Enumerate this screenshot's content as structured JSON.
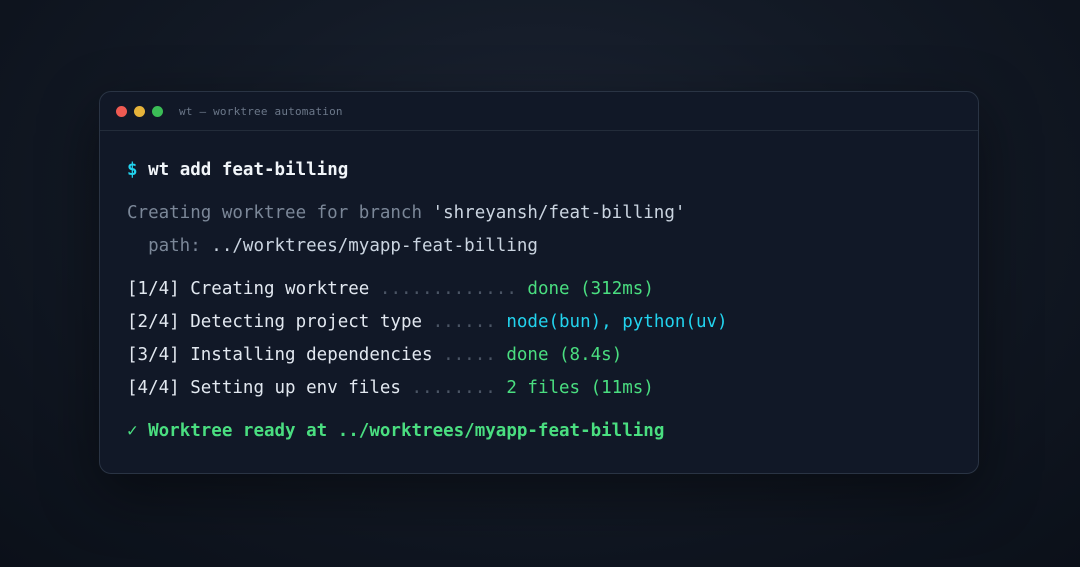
{
  "window": {
    "title": "wt — worktree automation"
  },
  "command": {
    "prompt": "$",
    "text": "wt add feat-billing"
  },
  "output": {
    "creating_prefix": "Creating worktree for branch ",
    "branch": "'shreyansh/feat-billing'",
    "path_label": "  path: ",
    "path_value": "../worktrees/myapp-feat-billing"
  },
  "steps": [
    {
      "index": "[1/4]",
      "label": "Creating worktree",
      "dots": ".............",
      "result": "done (312ms)",
      "result_color": "#4ade80"
    },
    {
      "index": "[2/4]",
      "label": "Detecting project type",
      "dots": "......",
      "result": "node(bun), python(uv)",
      "result_color": "#22d3ee"
    },
    {
      "index": "[3/4]",
      "label": "Installing dependencies",
      "dots": ".....",
      "result": "done (8.4s)",
      "result_color": "#4ade80"
    },
    {
      "index": "[4/4]",
      "label": "Setting up env files",
      "dots": "........",
      "result": "2 files (11ms)",
      "result_color": "#4ade80"
    }
  ],
  "final": {
    "check": "✓",
    "message": "Worktree ready at ../worktrees/myapp-feat-billing"
  },
  "colors": {
    "background": "#0f1520",
    "terminal_bg": "#111827",
    "prompt": "#22d3ee",
    "success": "#4ade80",
    "info": "#22d3ee"
  }
}
